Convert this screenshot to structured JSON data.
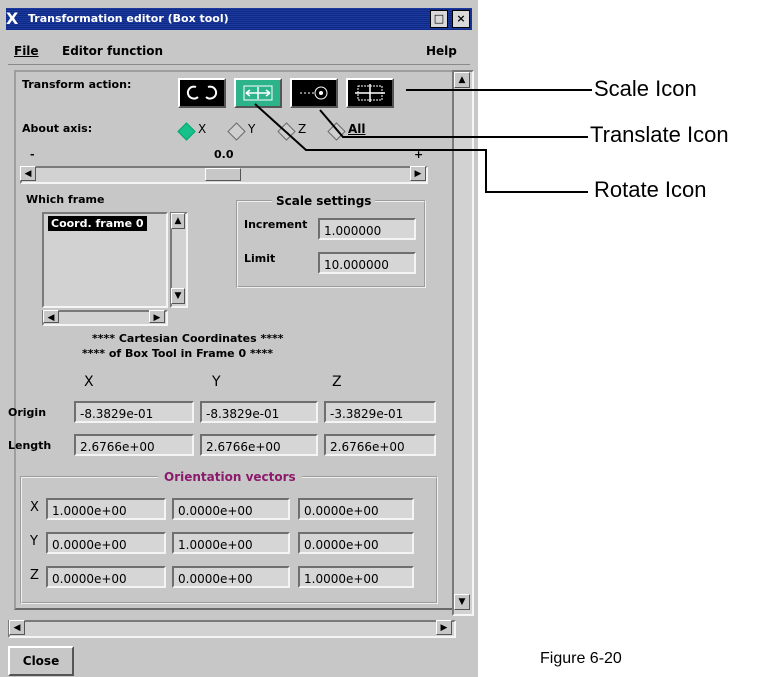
{
  "window": {
    "title": "Transformation editor (Box tool)",
    "minimize_label": "□",
    "close_label": "×"
  },
  "menu": {
    "file": "File",
    "editor_function": "Editor function",
    "help": "Help"
  },
  "transform": {
    "label": "Transform action:",
    "icons": [
      "rotate-icon",
      "translate-icon",
      "scale-icon",
      "box-resize-icon"
    ],
    "selected_index": 1
  },
  "axis": {
    "label": "About axis:",
    "options": [
      "X",
      "Y",
      "Z",
      "All"
    ],
    "selected": "X"
  },
  "slider": {
    "min_label": "-",
    "value": "0.0",
    "max_label": "+"
  },
  "frame": {
    "label": "Which frame",
    "items": [
      "Coord. frame 0"
    ]
  },
  "scale_settings": {
    "title": "Scale settings",
    "increment_label": "Increment",
    "increment_value": "1.000000",
    "limit_label": "Limit",
    "limit_value": "10.000000"
  },
  "coords": {
    "line1": "**** Cartesian Coordinates ****",
    "line2": "**** of Box Tool in Frame 0 ****",
    "headers": [
      "X",
      "Y",
      "Z"
    ],
    "origin_label": "Origin",
    "origin": [
      "-8.3829e-01",
      "-8.3829e-01",
      "-3.3829e-01"
    ],
    "length_label": "Length",
    "length": [
      "2.6766e+00",
      "2.6766e+00",
      "2.6766e+00"
    ]
  },
  "orientation": {
    "title": "Orientation vectors",
    "title_color": "#8b1a6b",
    "rows": [
      {
        "label": "X",
        "values": [
          "1.0000e+00",
          "0.0000e+00",
          "0.0000e+00"
        ]
      },
      {
        "label": "Y",
        "values": [
          "0.0000e+00",
          "1.0000e+00",
          "0.0000e+00"
        ]
      },
      {
        "label": "Z",
        "values": [
          "0.0000e+00",
          "0.0000e+00",
          "1.0000e+00"
        ]
      }
    ]
  },
  "close_button": "Close",
  "callouts": {
    "scale": "Scale Icon",
    "translate": "Translate Icon",
    "rotate": "Rotate Icon"
  },
  "figure_caption": "Figure 6-20",
  "colors": {
    "selected_icon": "#2db38a",
    "radio_selected": "#18c08c",
    "window_bg": "#c7c7c7",
    "titlebar": "#1c3a9e"
  }
}
